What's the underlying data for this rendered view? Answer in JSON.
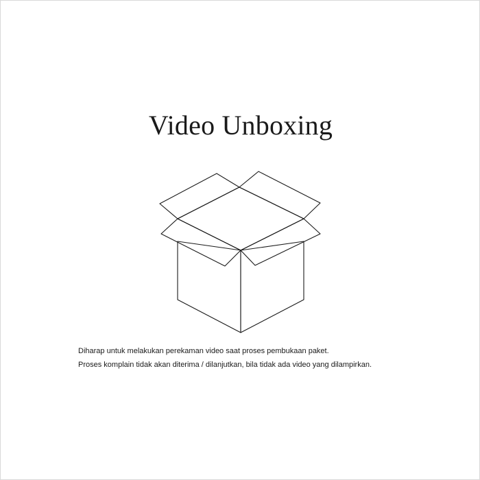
{
  "title": "Video Unboxing",
  "illustration": {
    "icon": "open-box-icon",
    "stroke_color": "#1a1a1a"
  },
  "notice": {
    "line1": "Diharap untuk melakukan perekaman video saat proses pembukaan paket.",
    "line2": "Proses komplain tidak akan diterima / dilanjutkan, bila tidak ada video yang dilampirkan."
  },
  "colors": {
    "background": "#ffffff",
    "text": "#1a1a1a",
    "border": "#d9d9d9"
  }
}
